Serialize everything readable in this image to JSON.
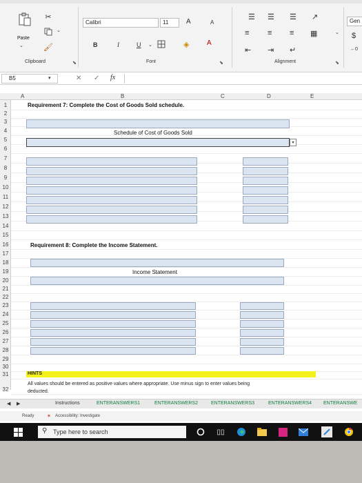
{
  "ribbon": {
    "clipboard_label": "Clipboard",
    "paste_label": "Paste",
    "font_label": "Font",
    "alignment_label": "Alignment",
    "font_name": "Calibri",
    "font_size": "11",
    "bold_label": "B",
    "italic_label": "I",
    "underline_label": "U",
    "grow_font": "A",
    "shrink_font": "A",
    "number_format": "Gen"
  },
  "formula_bar": {
    "name_box": "B5",
    "fx_label": "fx",
    "value": ""
  },
  "columns": [
    "A",
    "B",
    "C",
    "D",
    "E"
  ],
  "rows": [
    "1",
    "2",
    "3",
    "4",
    "5",
    "6",
    "7",
    "8",
    "9",
    "10",
    "11",
    "12",
    "13",
    "14",
    "15",
    "16",
    "17",
    "18",
    "19",
    "20",
    "21",
    "22",
    "23",
    "24",
    "25",
    "26",
    "27",
    "28",
    "29",
    "30",
    "31",
    "32"
  ],
  "sheet": {
    "req7": "Requirement 7: Complete the Cost of Goods Sold schedule.",
    "cogs_title": "Schedule of Cost of Goods Sold",
    "req8": "Requirement 8: Complete the Income Statement.",
    "is_title": "Income Statement",
    "hints_label": "HINTS",
    "hint_line1": "All values should be entered as positive values where appropriate. Use minus sign to enter values being",
    "hint_line2": "deducted."
  },
  "sheet_tabs": [
    "Instructions",
    "ENTERANSWERS1",
    "ENTERANSWERS2",
    "ENTERANSWERS3",
    "ENTERANSWERS4",
    "ENTERANSWE"
  ],
  "status": {
    "ready": "Ready",
    "accessibility": "Accessibility: Investigate"
  },
  "taskbar": {
    "search_placeholder": "Type here to search"
  }
}
